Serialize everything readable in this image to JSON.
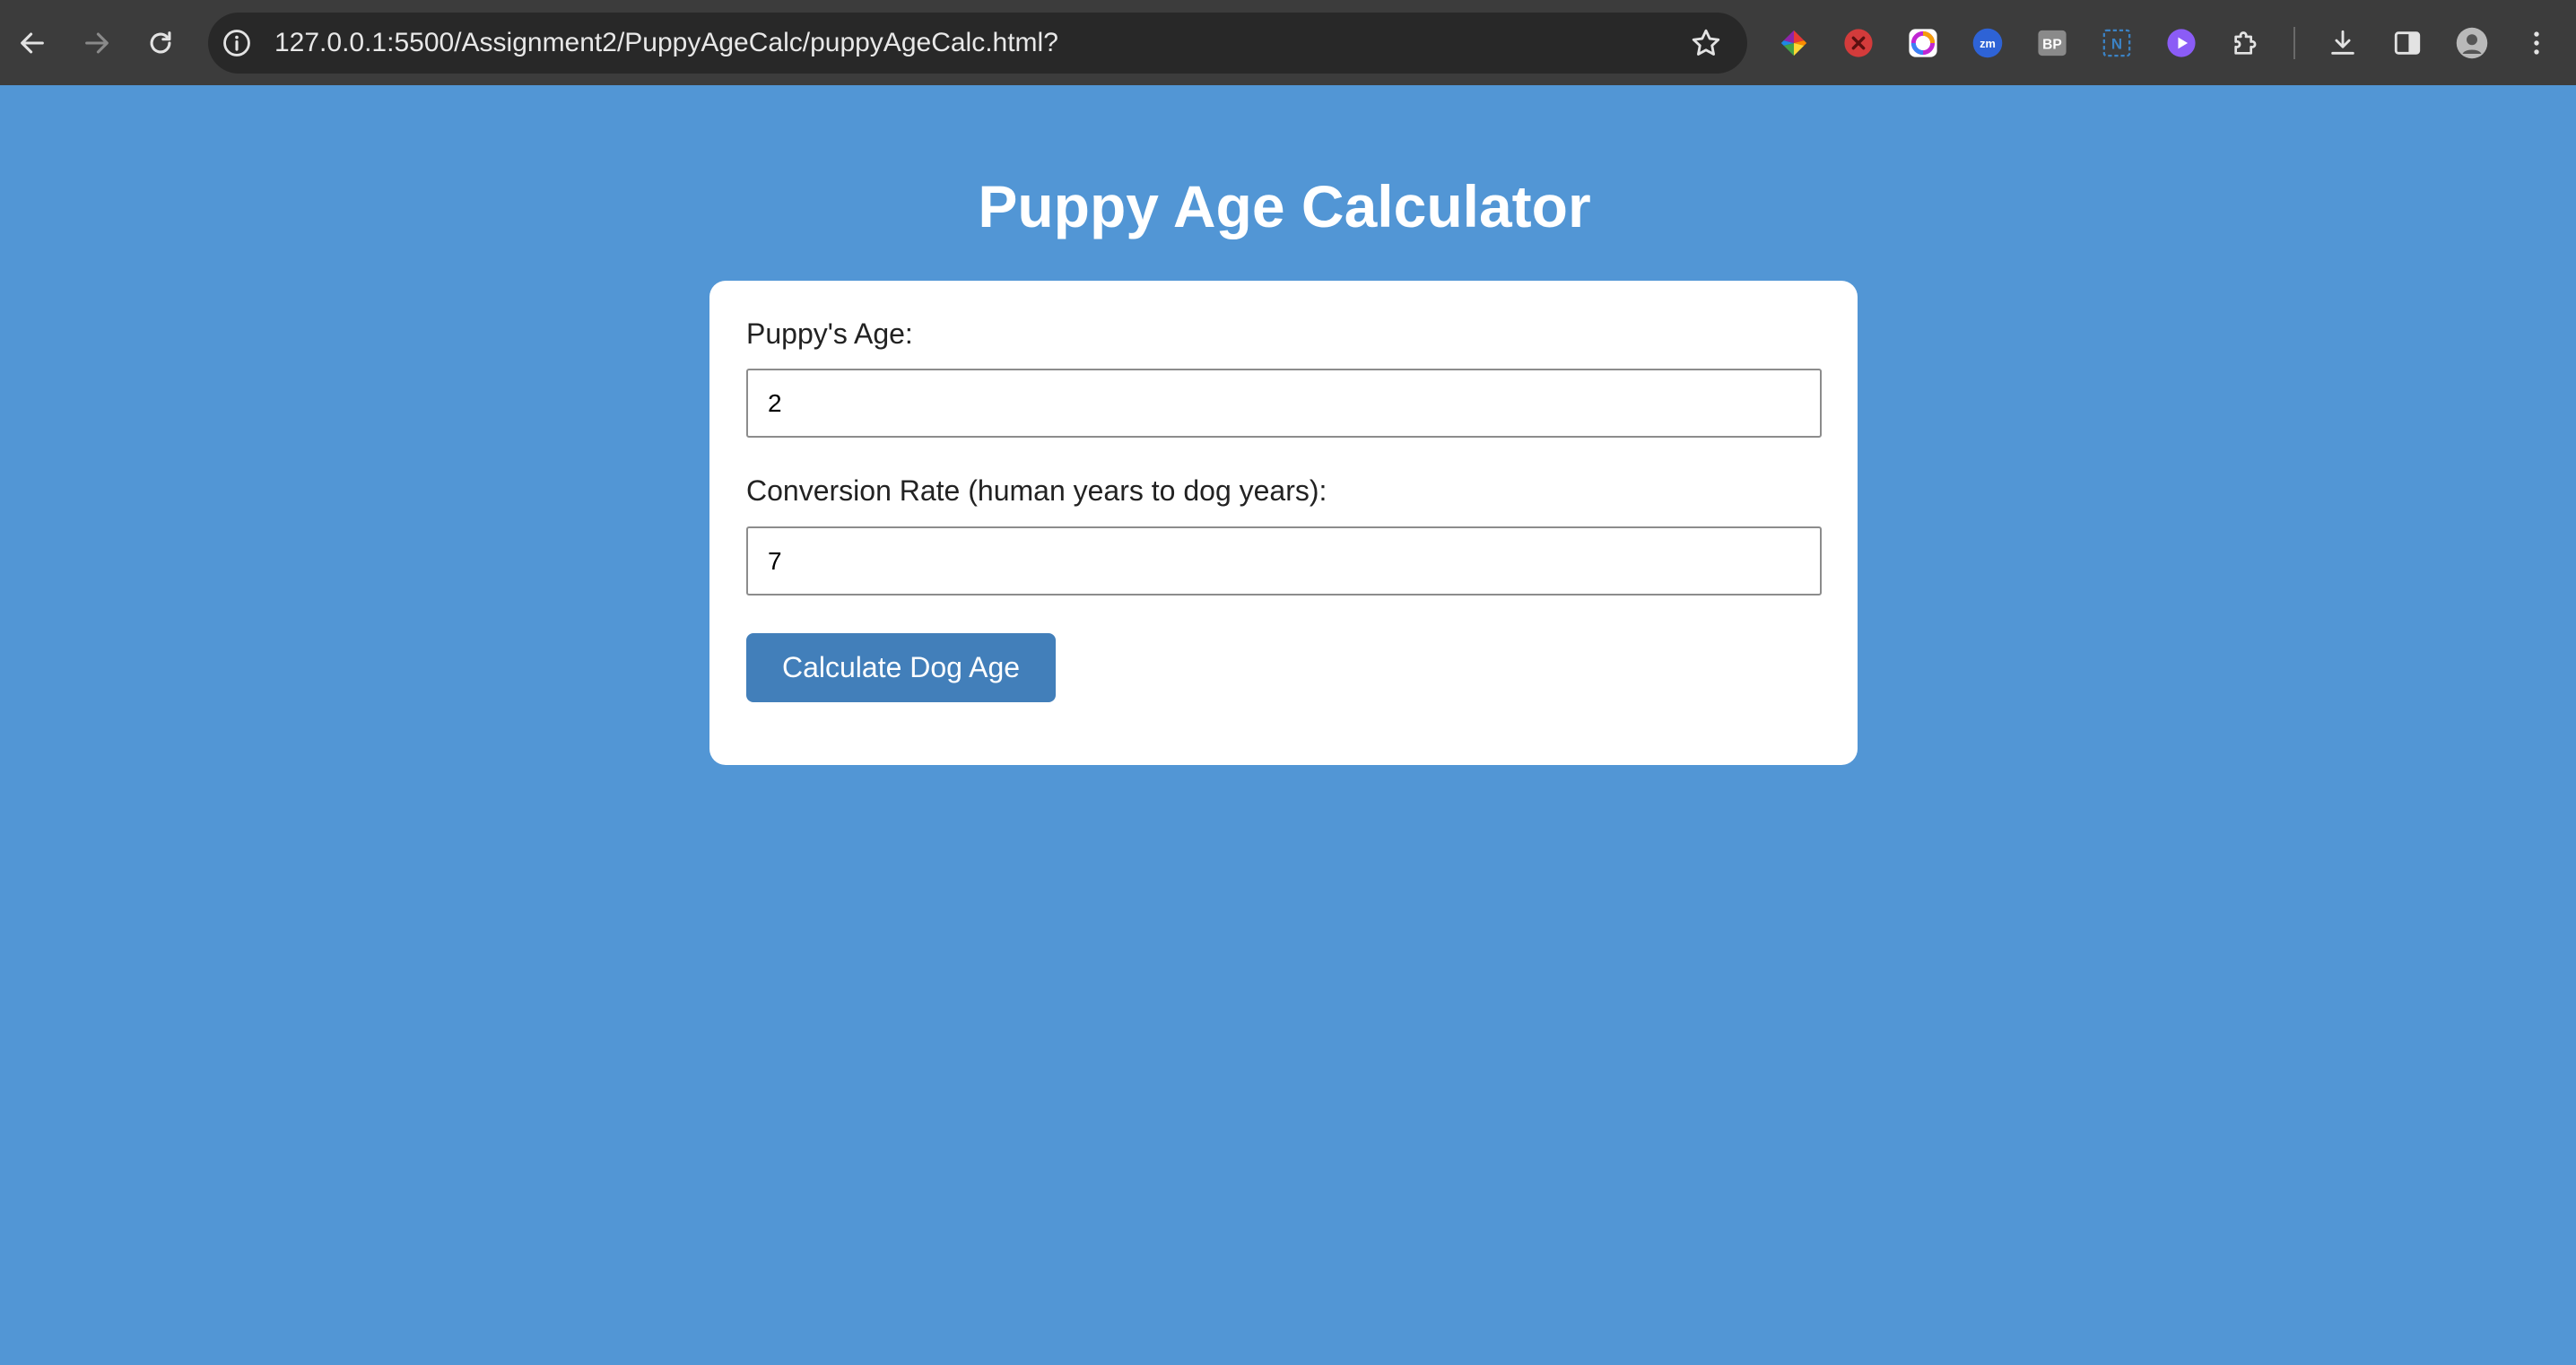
{
  "browser": {
    "url": "127.0.0.1:5500/Assignment2/PuppyAgeCalc/puppyAgeCalc.html?",
    "extension_labels": {
      "zoom": "zm",
      "bp": "BP",
      "notion": "N"
    },
    "icons": [
      "back-arrow-icon",
      "forward-arrow-icon",
      "reload-icon",
      "site-info-icon",
      "bookmark-star-icon",
      "color-wheel-extension-icon",
      "red-x-extension-icon",
      "colorful-ring-extension-icon",
      "zoom-extension-icon",
      "bp-extension-icon",
      "notion-extension-icon",
      "purple-play-extension-icon",
      "puzzle-extensions-icon",
      "download-icon",
      "side-panel-icon",
      "profile-avatar-icon",
      "more-menu-icon"
    ]
  },
  "page": {
    "title": "Puppy Age Calculator",
    "background_color": "#5296d5"
  },
  "form": {
    "age_label": "Puppy's Age:",
    "age_value": "2",
    "rate_label": "Conversion Rate (human years to dog years):",
    "rate_value": "7",
    "button_label": "Calculate Dog Age",
    "button_color": "#427fba"
  }
}
